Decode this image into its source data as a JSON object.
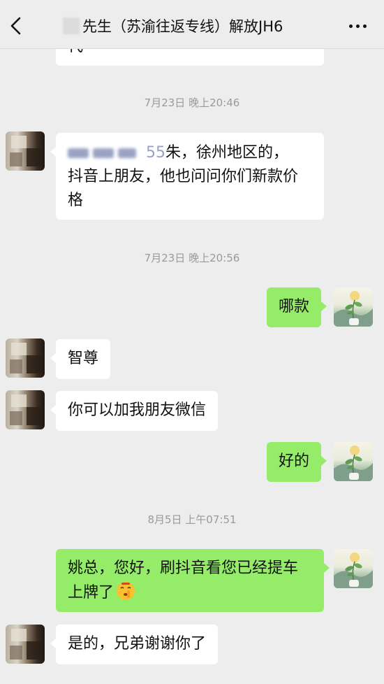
{
  "header": {
    "title": "先生（苏渝往返专线）解放JH6",
    "back_icon": "chevron-left-icon",
    "more_icon": "more-dots-icon"
  },
  "messages": {
    "prev_bubble_tail": "代",
    "ts1": "7月23日 晚上20:46",
    "m1_line1_partial": "55",
    "m1_line1": "朱，徐州地区的，",
    "m1_line2": "抖音上朋友，他也问问你们新款价",
    "m1_line3": "格",
    "ts2": "7月23日 晚上20:56",
    "m2": "哪款",
    "m3": "智尊",
    "m4": "你可以加我朋友微信",
    "m5": "好的",
    "ts3": "8月5日 上午07:51",
    "m6_line1": "姚总，您好，刷抖音看您已经提车",
    "m6_line2": "上牌了",
    "m6_emoji": "shushing-face-emoji",
    "m7": "是的，兄弟谢谢你了"
  },
  "colors": {
    "background": "#ededed",
    "incoming_bubble": "#ffffff",
    "outgoing_bubble": "#95ec69",
    "timestamp": "#9a9a9a"
  }
}
